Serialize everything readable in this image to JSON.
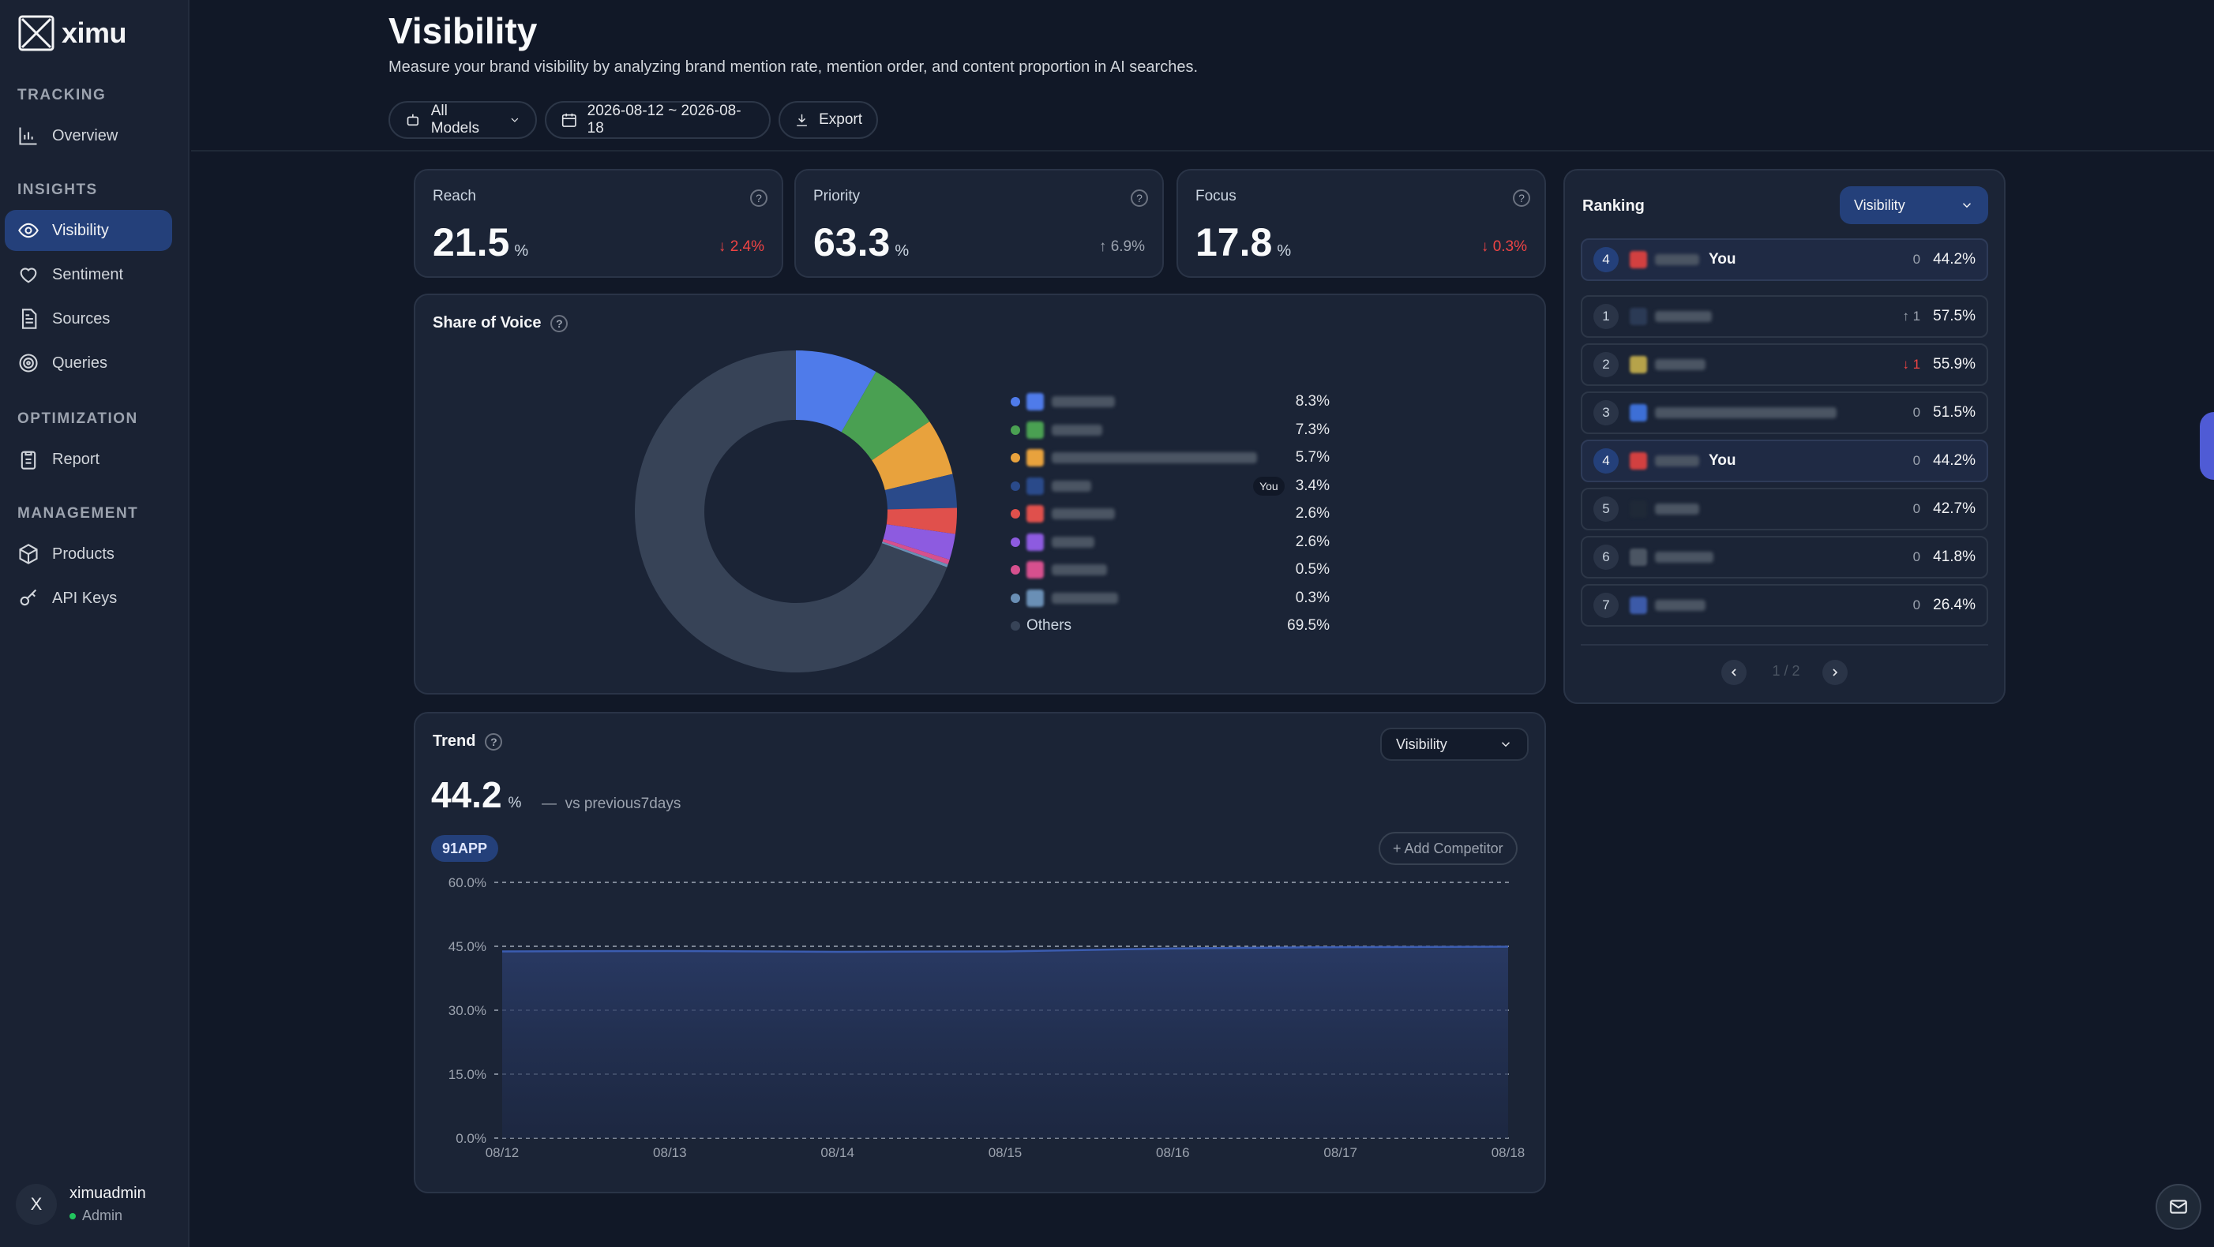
{
  "app": {
    "name": "ximu"
  },
  "sidebar": {
    "sections": [
      {
        "label": "TRACKING",
        "items": [
          {
            "label": "Overview",
            "icon": "bar-chart-icon"
          }
        ]
      },
      {
        "label": "INSIGHTS",
        "items": [
          {
            "label": "Visibility",
            "icon": "eye-icon",
            "active": true
          },
          {
            "label": "Sentiment",
            "icon": "heart-icon"
          },
          {
            "label": "Sources",
            "icon": "document-icon"
          },
          {
            "label": "Queries",
            "icon": "target-icon"
          }
        ]
      },
      {
        "label": "OPTIMIZATION",
        "items": [
          {
            "label": "Report",
            "icon": "clipboard-icon"
          }
        ]
      },
      {
        "label": "MANAGEMENT",
        "items": [
          {
            "label": "Products",
            "icon": "box-icon"
          },
          {
            "label": "API Keys",
            "icon": "key-icon"
          }
        ]
      }
    ],
    "user": {
      "initial": "X",
      "name": "ximuadmin",
      "role": "Admin"
    }
  },
  "header": {
    "title": "Visibility",
    "subtitle": "Measure your brand visibility by analyzing brand mention rate, mention order, and content proportion in AI searches.",
    "model_filter": "All Models",
    "date_range": "2026-08-12 ~ 2026-08-18",
    "export_label": "Export"
  },
  "metrics": [
    {
      "label": "Reach",
      "value": "21.5",
      "unit": "%",
      "delta": "2.4%",
      "direction": "down"
    },
    {
      "label": "Priority",
      "value": "63.3",
      "unit": "%",
      "delta": "6.9%",
      "direction": "up"
    },
    {
      "label": "Focus",
      "value": "17.8",
      "unit": "%",
      "delta": "0.3%",
      "direction": "down"
    }
  ],
  "share_of_voice": {
    "title": "Share of Voice",
    "you_label": "You",
    "others_label": "Others",
    "colors": [
      "#4f7bea",
      "#4aa052",
      "#e8a23d",
      "#2a4a8a",
      "#e0504c",
      "#8d5be0",
      "#d6508e",
      "#6a8fb5",
      "#374357"
    ],
    "slices": [
      {
        "pct": "8.3%",
        "value": 8.3,
        "name_width": 80
      },
      {
        "pct": "7.3%",
        "value": 7.3,
        "name_width": 64
      },
      {
        "pct": "5.7%",
        "value": 5.7,
        "name_width": 260
      },
      {
        "pct": "3.4%",
        "value": 3.4,
        "name_width": 50,
        "you": true
      },
      {
        "pct": "2.6%",
        "value": 2.6,
        "name_width": 80
      },
      {
        "pct": "2.6%",
        "value": 2.6,
        "name_width": 54
      },
      {
        "pct": "0.5%",
        "value": 0.5,
        "name_width": 70
      },
      {
        "pct": "0.3%",
        "value": 0.3,
        "name_width": 84
      },
      {
        "pct": "69.5%",
        "value": 69.5,
        "others": true
      }
    ]
  },
  "ranking": {
    "title": "Ranking",
    "metric": "Visibility",
    "you_label": "You",
    "pinned": {
      "rank": "4",
      "change": "0",
      "pct": "44.2%",
      "name_width": 56
    },
    "rows": [
      {
        "rank": "1",
        "change": "1",
        "dir": "up",
        "pct": "57.5%",
        "name_width": 72
      },
      {
        "rank": "2",
        "change": "1",
        "dir": "down",
        "pct": "55.9%",
        "name_width": 64
      },
      {
        "rank": "3",
        "change": "0",
        "dir": "flat",
        "pct": "51.5%",
        "name_width": 230
      },
      {
        "rank": "4",
        "change": "0",
        "dir": "flat",
        "pct": "44.2%",
        "name_width": 56,
        "you": true
      },
      {
        "rank": "5",
        "change": "0",
        "dir": "flat",
        "pct": "42.7%",
        "name_width": 56
      },
      {
        "rank": "6",
        "change": "0",
        "dir": "flat",
        "pct": "41.8%",
        "name_width": 74
      },
      {
        "rank": "7",
        "change": "0",
        "dir": "flat",
        "pct": "26.4%",
        "name_width": 64
      }
    ],
    "page": "1 / 2"
  },
  "trend": {
    "title": "Trend",
    "metric": "Visibility",
    "value": "44.2",
    "unit": "%",
    "dash": "—",
    "comparison": "vs previous7days",
    "tag": "91APP",
    "add_competitor": "+ Add Competitor"
  },
  "chart_data": {
    "type": "area",
    "x": [
      "08/12",
      "08/13",
      "08/14",
      "08/15",
      "08/16",
      "08/17",
      "08/18"
    ],
    "series": [
      {
        "name": "91APP",
        "values": [
          43.8,
          43.9,
          43.7,
          43.8,
          44.5,
          44.8,
          44.9
        ]
      }
    ],
    "yticks": [
      "60.0%",
      "45.0%",
      "30.0%",
      "15.0%",
      "0.0%"
    ],
    "ylim": [
      0,
      60
    ],
    "grid": true
  }
}
